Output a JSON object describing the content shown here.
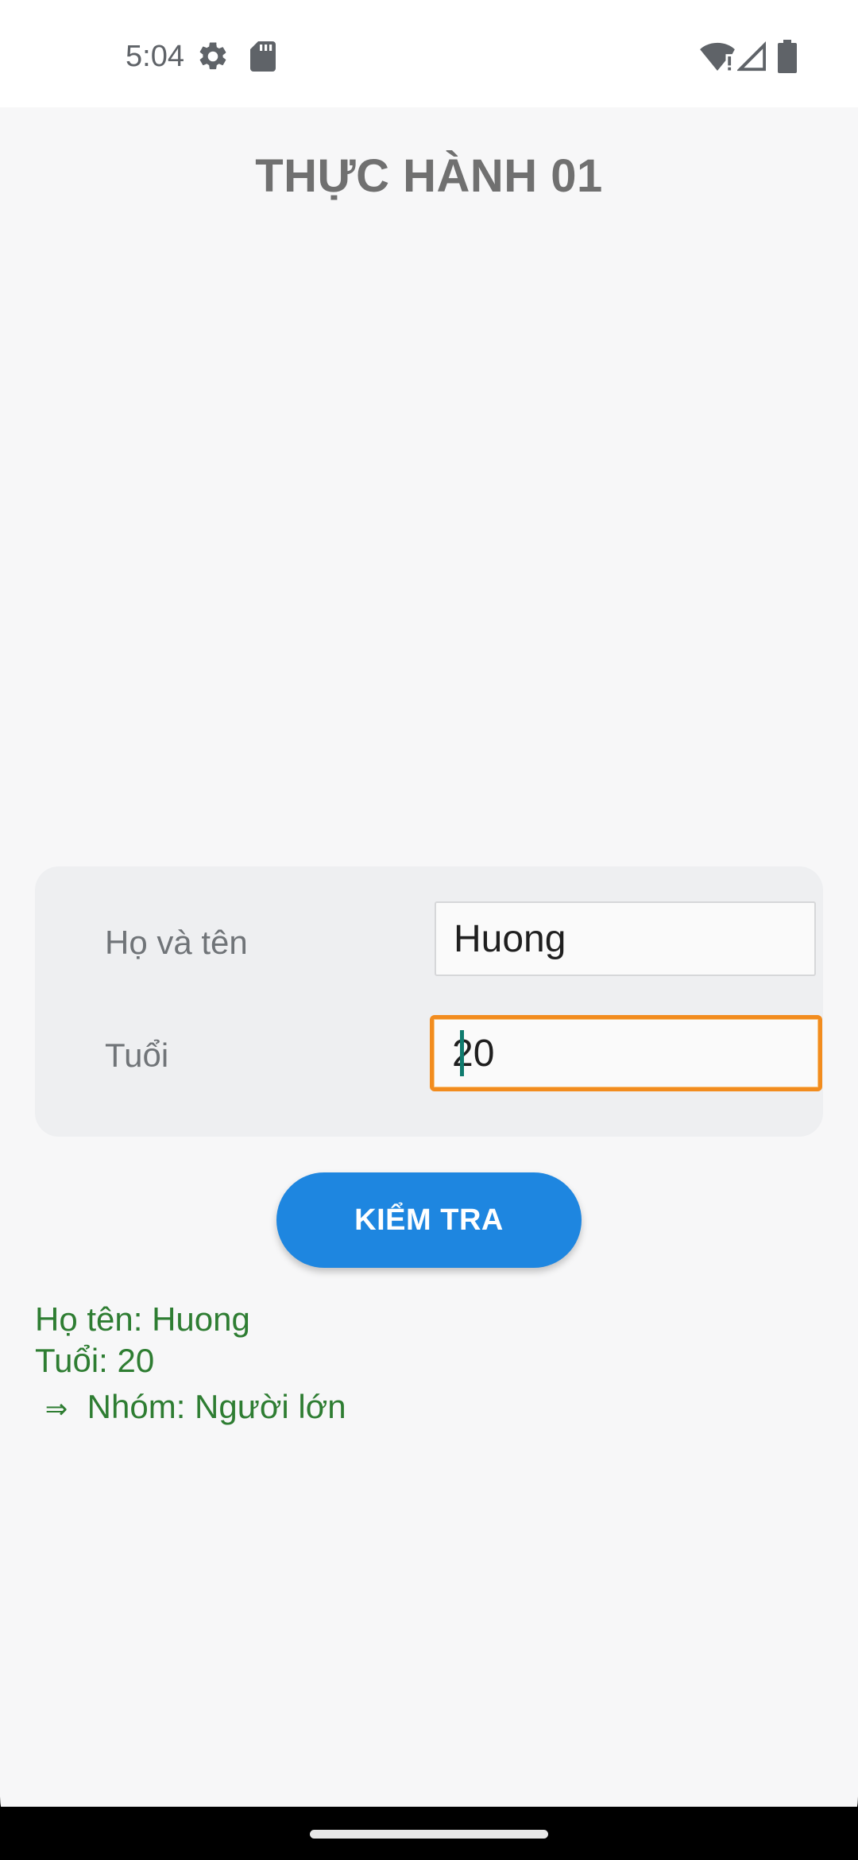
{
  "status_bar": {
    "time": "5:04",
    "icons": [
      "settings-gear-icon",
      "sd-card-icon",
      "wifi-alert-icon",
      "cell-signal-icon",
      "battery-icon"
    ]
  },
  "page": {
    "title": "THỰC HÀNH 01"
  },
  "form": {
    "name_label": "Họ và tên",
    "name_value": "Huong",
    "age_label": "Tuổi",
    "age_value": "20"
  },
  "button": {
    "label": "KIỂM TRA"
  },
  "result": {
    "name_line": "Họ tên: Huong",
    "age_line": "Tuổi: 20",
    "arrow": "⇒",
    "group_line": "Nhóm: Người lớn"
  },
  "colors": {
    "accent_button": "#1e86e0",
    "focus_border": "#f28c1e",
    "result_text": "#2e7d32",
    "title_text": "#707070"
  }
}
